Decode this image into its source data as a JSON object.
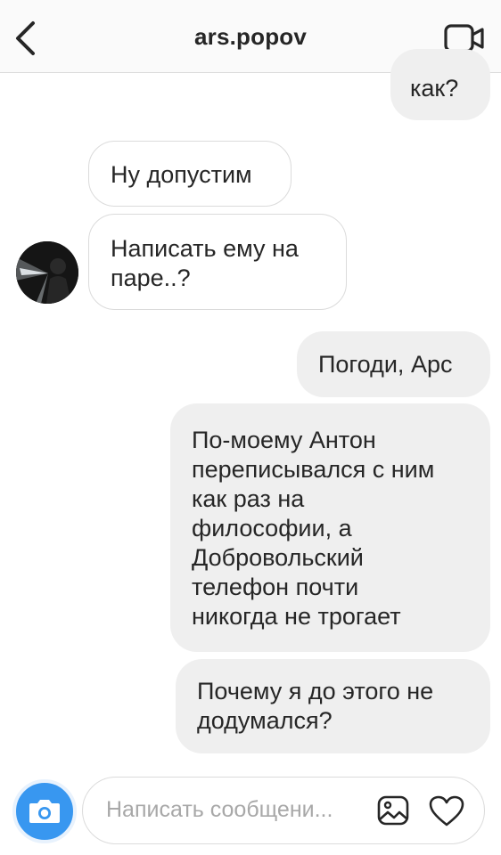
{
  "header": {
    "title": "ars.popov"
  },
  "messages": [
    {
      "direction": "sent",
      "text": "как?"
    },
    {
      "direction": "received",
      "text": "Ну допустим"
    },
    {
      "direction": "received",
      "lines": [
        "Написать ему на",
        "паре..?"
      ]
    },
    {
      "direction": "sent",
      "text": "Погоди, Арс"
    },
    {
      "direction": "sent",
      "lines": [
        "По-моему Антон",
        "переписывался с ним",
        "как раз на",
        "философии, а",
        "Добровольский",
        "телефон почти",
        "никогда не трогает"
      ]
    },
    {
      "direction": "sent",
      "lines": [
        "Почему я до этого не",
        "додумался?"
      ]
    }
  ],
  "composer": {
    "placeholder": "Написать сообщени..."
  },
  "colors": {
    "accent": "#3897f0",
    "sent_bubble": "#efefef",
    "border": "#dbdbdb"
  },
  "icons": {
    "back": "chevron-left-icon",
    "video": "video-camera-icon",
    "camera": "camera-icon",
    "gallery": "image-icon",
    "like": "heart-icon"
  }
}
